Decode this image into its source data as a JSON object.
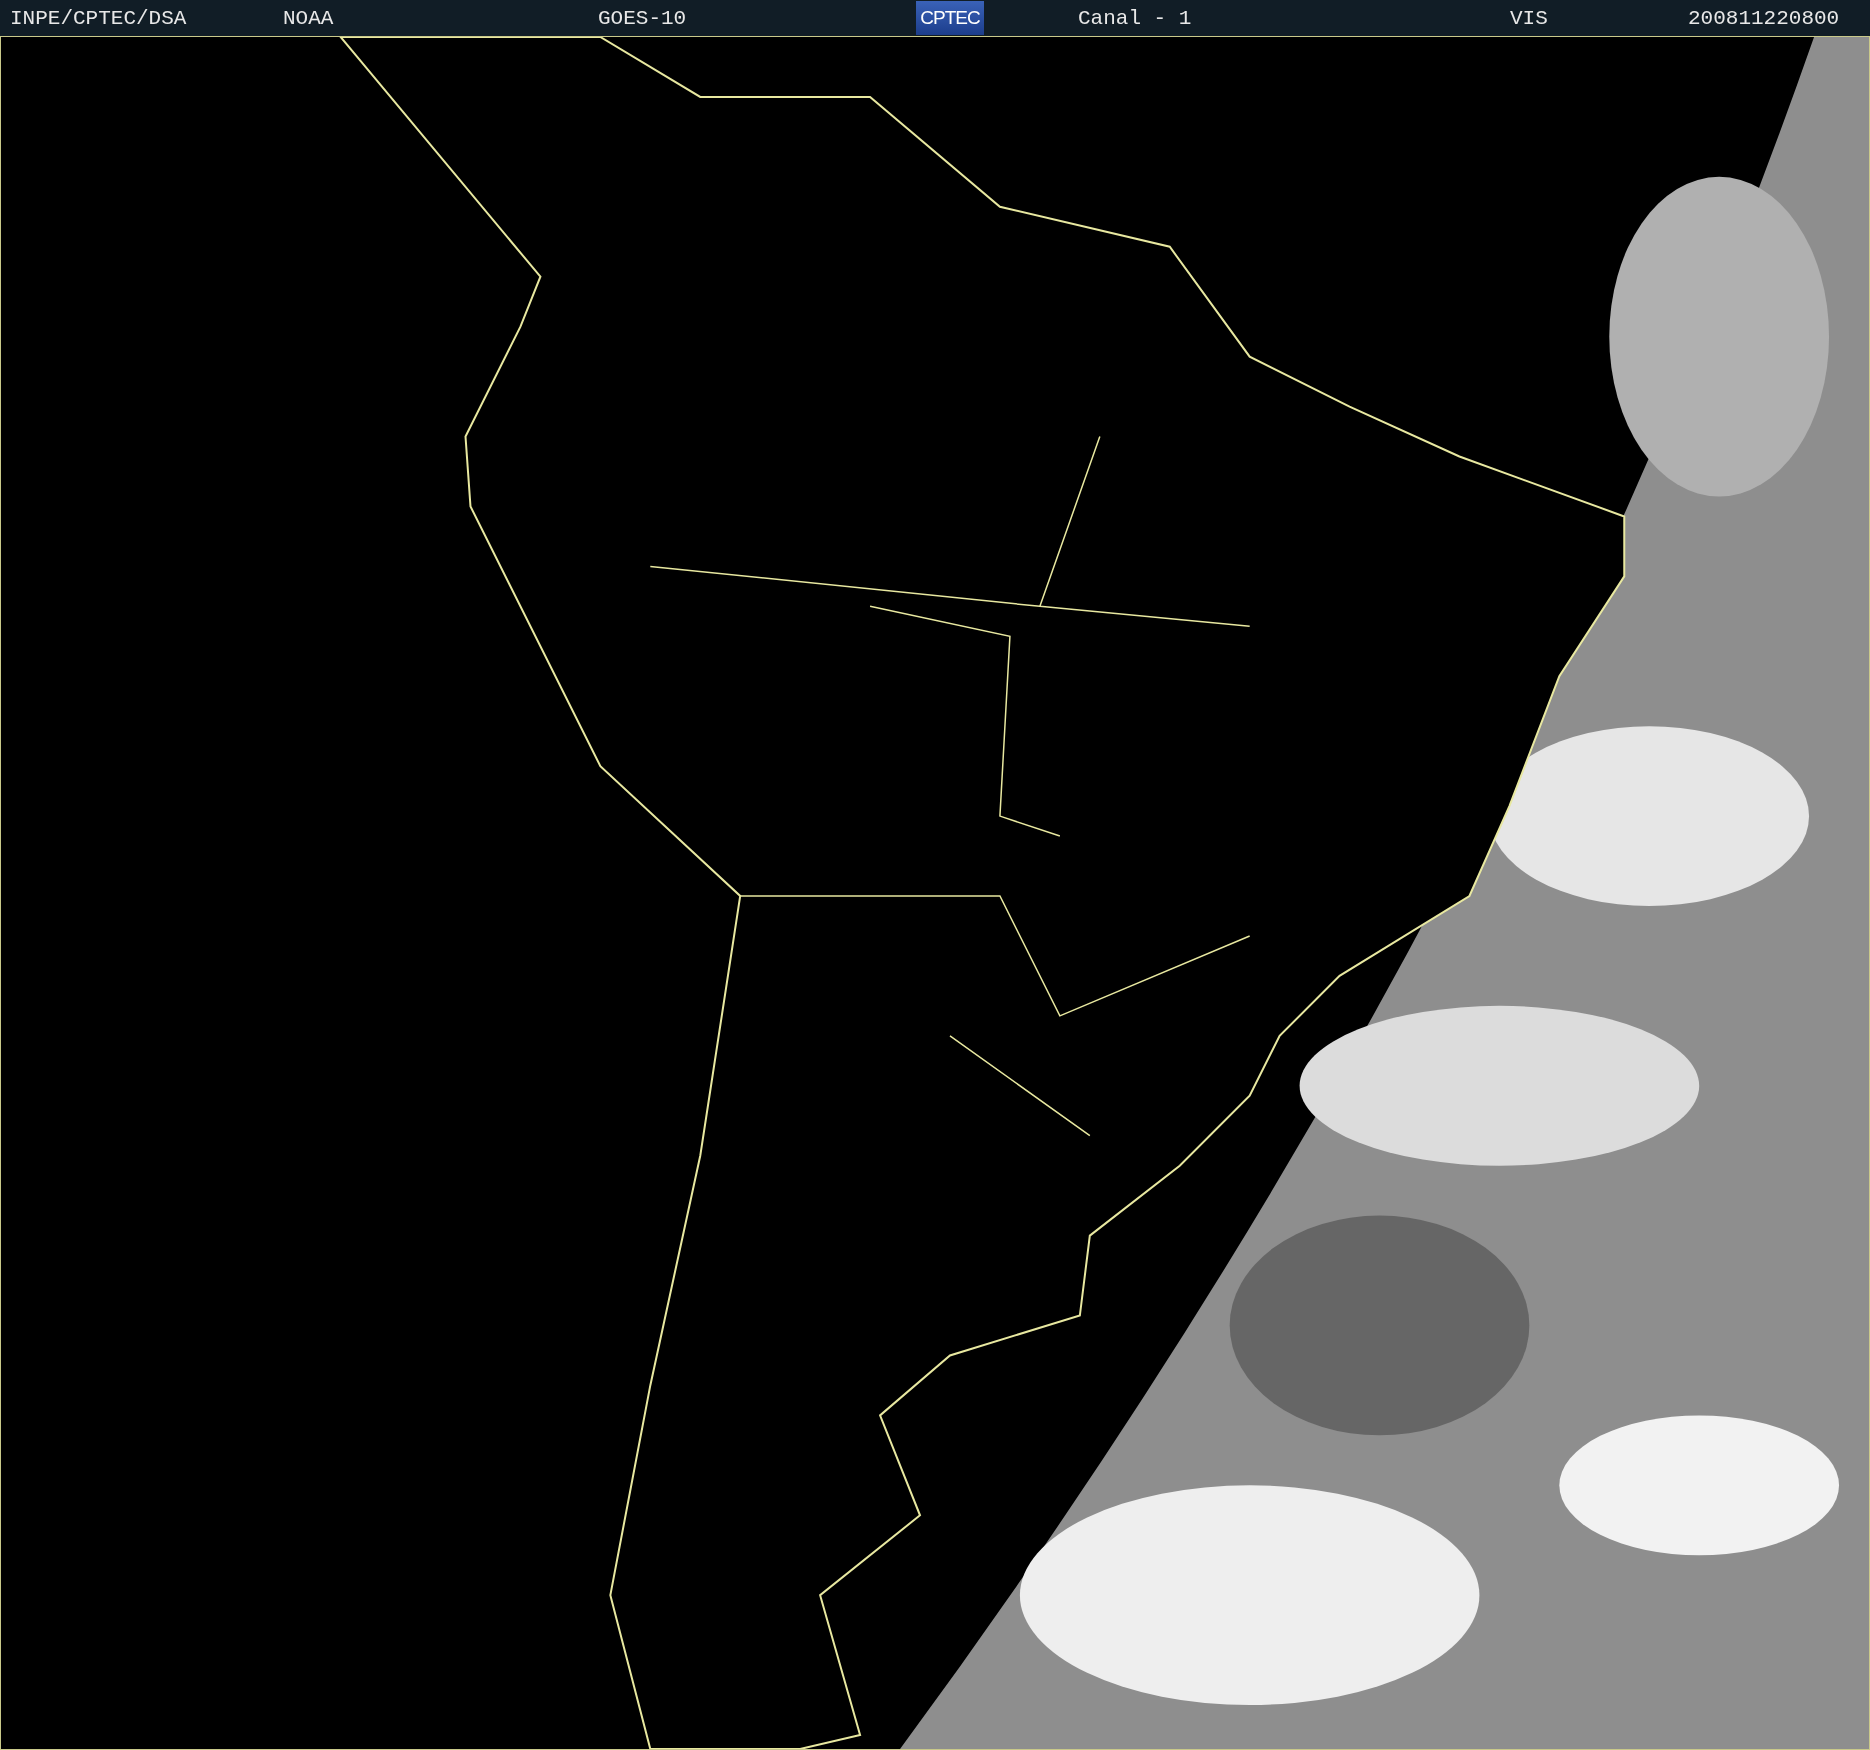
{
  "header": {
    "fields": [
      {
        "kind": "text",
        "text": "INPE/CPTEC/DSA"
      },
      {
        "kind": "text",
        "text": "NOAA"
      },
      {
        "kind": "text",
        "text": "GOES-10"
      },
      {
        "kind": "logo",
        "text": "CPTEC"
      },
      {
        "kind": "text",
        "text": "Canal - 1"
      },
      {
        "kind": "text",
        "text": "VIS"
      },
      {
        "kind": "text",
        "text": "200811220800"
      }
    ]
  }
}
